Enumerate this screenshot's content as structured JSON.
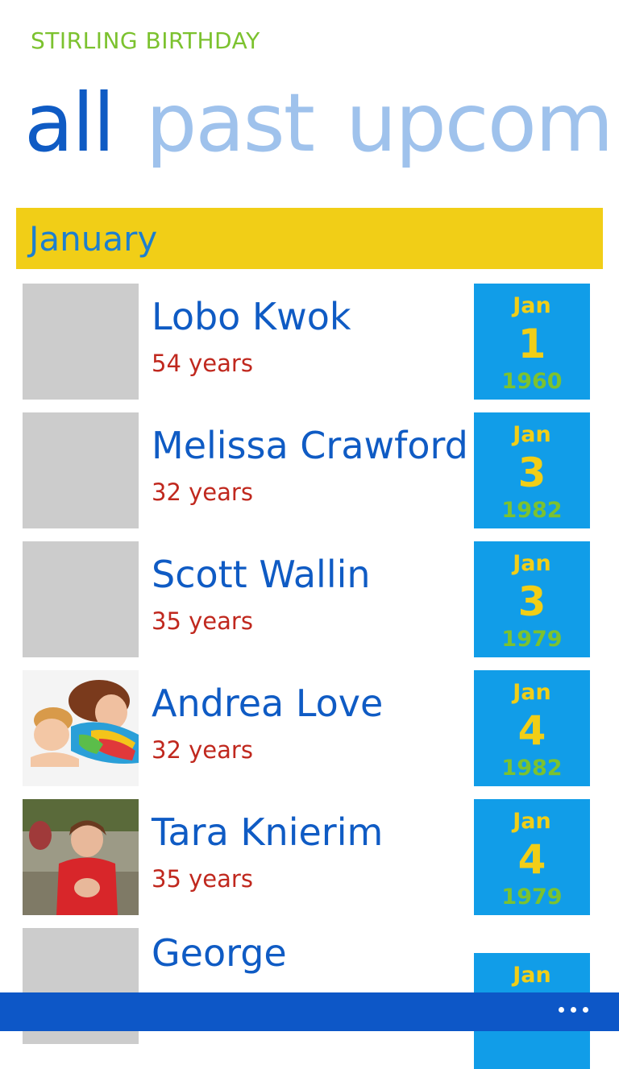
{
  "app": {
    "title": "STIRLING BIRTHDAY"
  },
  "pivot": {
    "items": [
      "all",
      "past",
      "upcoming"
    ]
  },
  "group": {
    "month": "January"
  },
  "contacts": [
    {
      "name": "Lobo Kwok",
      "age": "54 years",
      "month": "Jan",
      "day": "1",
      "year": "1960",
      "photo": "placeholder"
    },
    {
      "name": "Melissa Crawford",
      "age": "32 years",
      "month": "Jan",
      "day": "3",
      "year": "1982",
      "photo": "placeholder"
    },
    {
      "name": "Scott Wallin",
      "age": "35 years",
      "month": "Jan",
      "day": "3",
      "year": "1979",
      "photo": "placeholder"
    },
    {
      "name": "Andrea Love",
      "age": "32 years",
      "month": "Jan",
      "day": "4",
      "year": "1982",
      "photo": "photo-mother-child"
    },
    {
      "name": "Tara Knierim",
      "age": "35 years",
      "month": "Jan",
      "day": "4",
      "year": "1979",
      "photo": "photo-outdoor"
    },
    {
      "name": "George",
      "age": "",
      "month": "Jan",
      "day": "",
      "year": "",
      "photo": "placeholder"
    }
  ],
  "appbar": {
    "more_icon": "ellipsis-icon"
  },
  "colors": {
    "accent": "#0f5bc4",
    "month_header": "#f1ce17",
    "date_tile": "#119de8",
    "age_text": "#c0281e",
    "year_text": "#7cc22f"
  }
}
